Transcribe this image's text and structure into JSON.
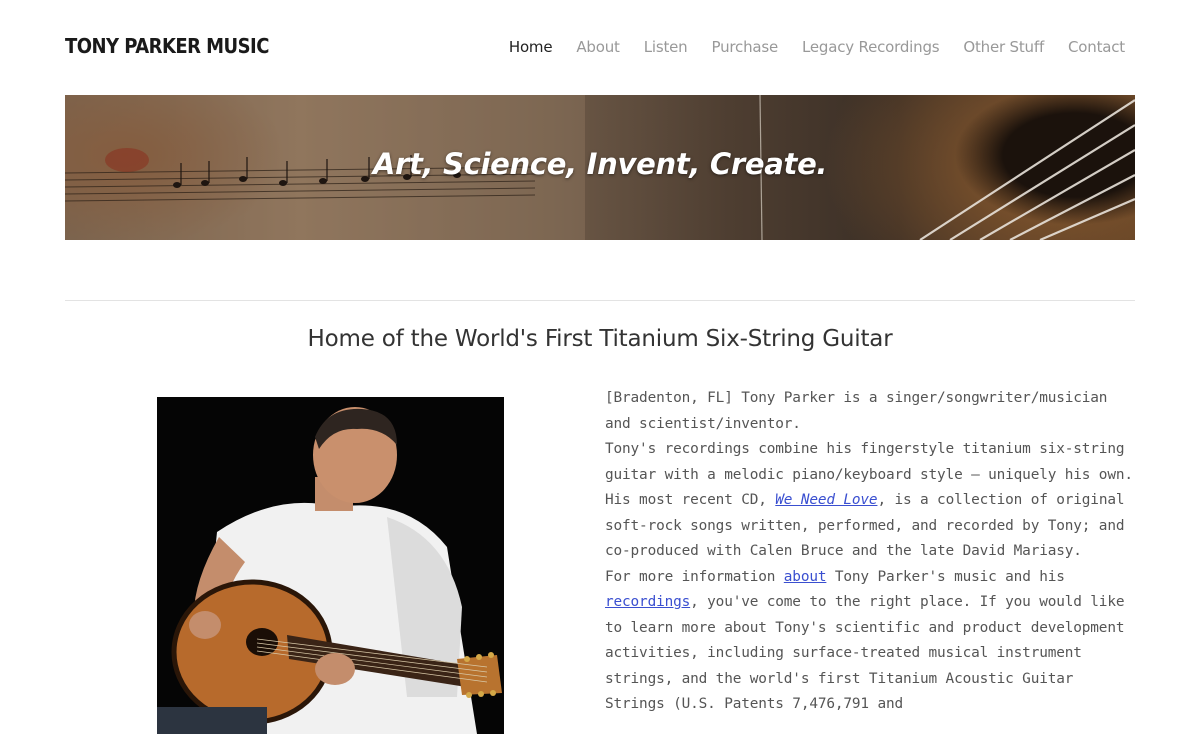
{
  "header": {
    "site_title": "TONY PARKER MUSIC",
    "nav": [
      {
        "label": "Home",
        "active": true
      },
      {
        "label": "About"
      },
      {
        "label": "Listen"
      },
      {
        "label": "Purchase"
      },
      {
        "label": "Legacy Recordings"
      },
      {
        "label": "Other Stuff"
      },
      {
        "label": "Contact"
      }
    ]
  },
  "banner": {
    "caption": "Art, Science, Invent, Create."
  },
  "main": {
    "heading": "Home of the World's First Titanium Six-String Guitar",
    "bio": {
      "p1": "[Bradenton, FL] Tony Parker is a singer/songwriter/musician and scientist/inventor.",
      "p2_before": "Tony's recordings combine his fingerstyle titanium six-string guitar with a melodic piano/keyboard style — uniquely his own. His most recent CD, ",
      "p2_link": "We Need Love",
      "p2_after": ", is a collection of original soft-rock songs written, performed, and recorded by Tony; and co-produced with Calen Bruce and the late David Mariasy.",
      "p3_before": "For more information ",
      "p3_link1": "about",
      "p3_mid": " Tony Parker's music and his ",
      "p3_link2": "recordings",
      "p3_after": ", you've come to the right place. If you would like to learn more about Tony's scientific and product development activities, including surface-treated musical instrument strings, and the world's first Titanium Acoustic Guitar Strings (U.S. Patents 7,476,791 and"
    }
  },
  "colors": {
    "nav_active": "#222222",
    "nav_inactive": "#999999",
    "link": "#3a4fd0",
    "body_text": "#555555"
  }
}
